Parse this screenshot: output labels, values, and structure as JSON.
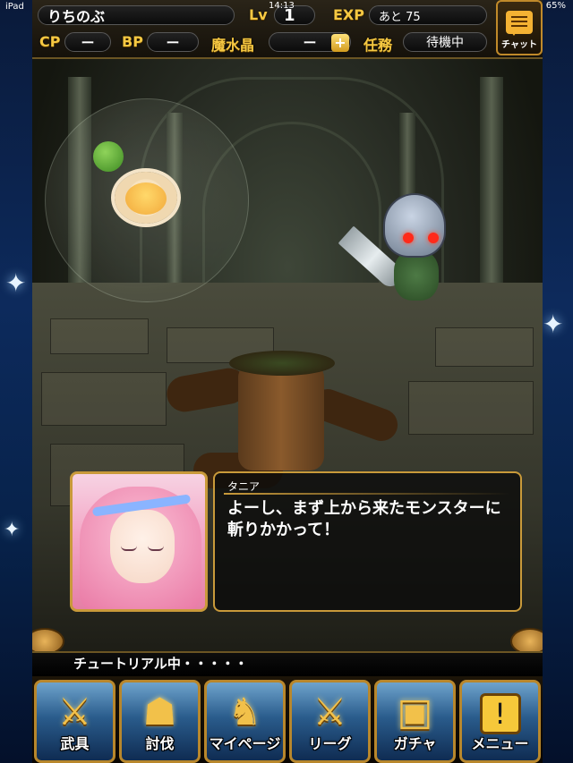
{
  "status_bar": {
    "device": "iPad",
    "time": "14:13",
    "battery": "65%"
  },
  "header": {
    "player_name": "りちのぶ",
    "lv_label": "Lv",
    "lv_value": "1",
    "exp_label": "EXP",
    "exp_value": "あと 75",
    "cp_label": "CP",
    "cp_value": "ー",
    "bp_label": "BP",
    "bp_value": "ー",
    "crystal_label": "魔水晶",
    "crystal_value": "ー",
    "crystal_add": "+",
    "mission_label": "任務",
    "mission_value": "待機中",
    "chat_label": "チャット"
  },
  "dialog": {
    "speaker": "タニア",
    "text": "よーし、まず上から来たモンスターに斬りかかって！"
  },
  "tutorial": {
    "text": "チュートリアル中・・・・・"
  },
  "menu": {
    "items": [
      {
        "label": "武具",
        "icon": "sword-icon",
        "glyph": "⚔"
      },
      {
        "label": "討伐",
        "icon": "monster-icon",
        "glyph": "☗"
      },
      {
        "label": "マイページ",
        "icon": "knight-icon",
        "glyph": "♞"
      },
      {
        "label": "リーグ",
        "icon": "crossed-swords-icon",
        "glyph": "⚔"
      },
      {
        "label": "ガチャ",
        "icon": "treasure-chest-icon",
        "glyph": "▣"
      },
      {
        "label": "メニュー",
        "icon": "exclamation-icon",
        "glyph": "!"
      }
    ]
  },
  "colors": {
    "gold": "#f5c842",
    "frame": "#c99a3a",
    "menu_blue": "#2a5c8c"
  }
}
